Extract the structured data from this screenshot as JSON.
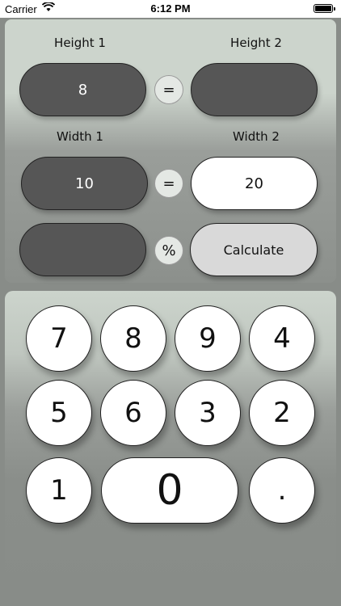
{
  "status_bar": {
    "carrier": "Carrier",
    "time": "6:12 PM",
    "wifi_icon": "wifi-icon",
    "battery_icon": "battery-icon"
  },
  "calculator": {
    "height1_label": "Height 1",
    "height2_label": "Height 2",
    "width1_label": "Width 1",
    "width2_label": "Width 2",
    "height1_value": "8",
    "height2_value": "",
    "width1_value": "10",
    "width2_value": "20",
    "result_value": "",
    "equals_symbol": "=",
    "percent_symbol": "%",
    "calculate_label": "Calculate"
  },
  "keypad": {
    "keys": [
      "7",
      "8",
      "9",
      "4",
      "5",
      "6",
      "3",
      "2",
      "1",
      "0",
      "."
    ]
  },
  "colors": {
    "dark_field": "#565656",
    "light_field": "#ffffff",
    "calculate_bg": "#d9d9d9",
    "panel_light": "#ccd4cc",
    "panel_dark": "#888c88"
  }
}
